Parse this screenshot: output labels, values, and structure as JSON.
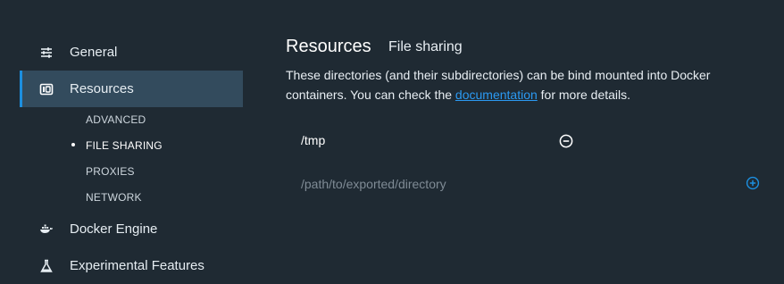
{
  "sidebar": {
    "items": [
      {
        "label": "General",
        "icon": "sliders-icon"
      },
      {
        "label": "Resources",
        "icon": "resources-icon"
      },
      {
        "label": "Docker Engine",
        "icon": "whale-icon"
      },
      {
        "label": "Experimental Features",
        "icon": "flask-icon"
      }
    ],
    "subitems": [
      {
        "label": "ADVANCED"
      },
      {
        "label": "FILE SHARING"
      },
      {
        "label": "PROXIES"
      },
      {
        "label": "NETWORK"
      }
    ]
  },
  "main": {
    "title": "Resources",
    "subtitle": "File sharing",
    "description_before": "These directories (and their subdirectories) can be bind mounted into Docker containers. You can check the ",
    "link": "documentation",
    "description_after": " for more details.",
    "shares": [
      {
        "path": "/tmp"
      }
    ],
    "new_path_placeholder": "/path/to/exported/directory"
  },
  "colors": {
    "background": "#1f2a33",
    "active_item_bg": "#334b5d",
    "accent": "#1c8fe0",
    "link": "#2b9af3"
  }
}
